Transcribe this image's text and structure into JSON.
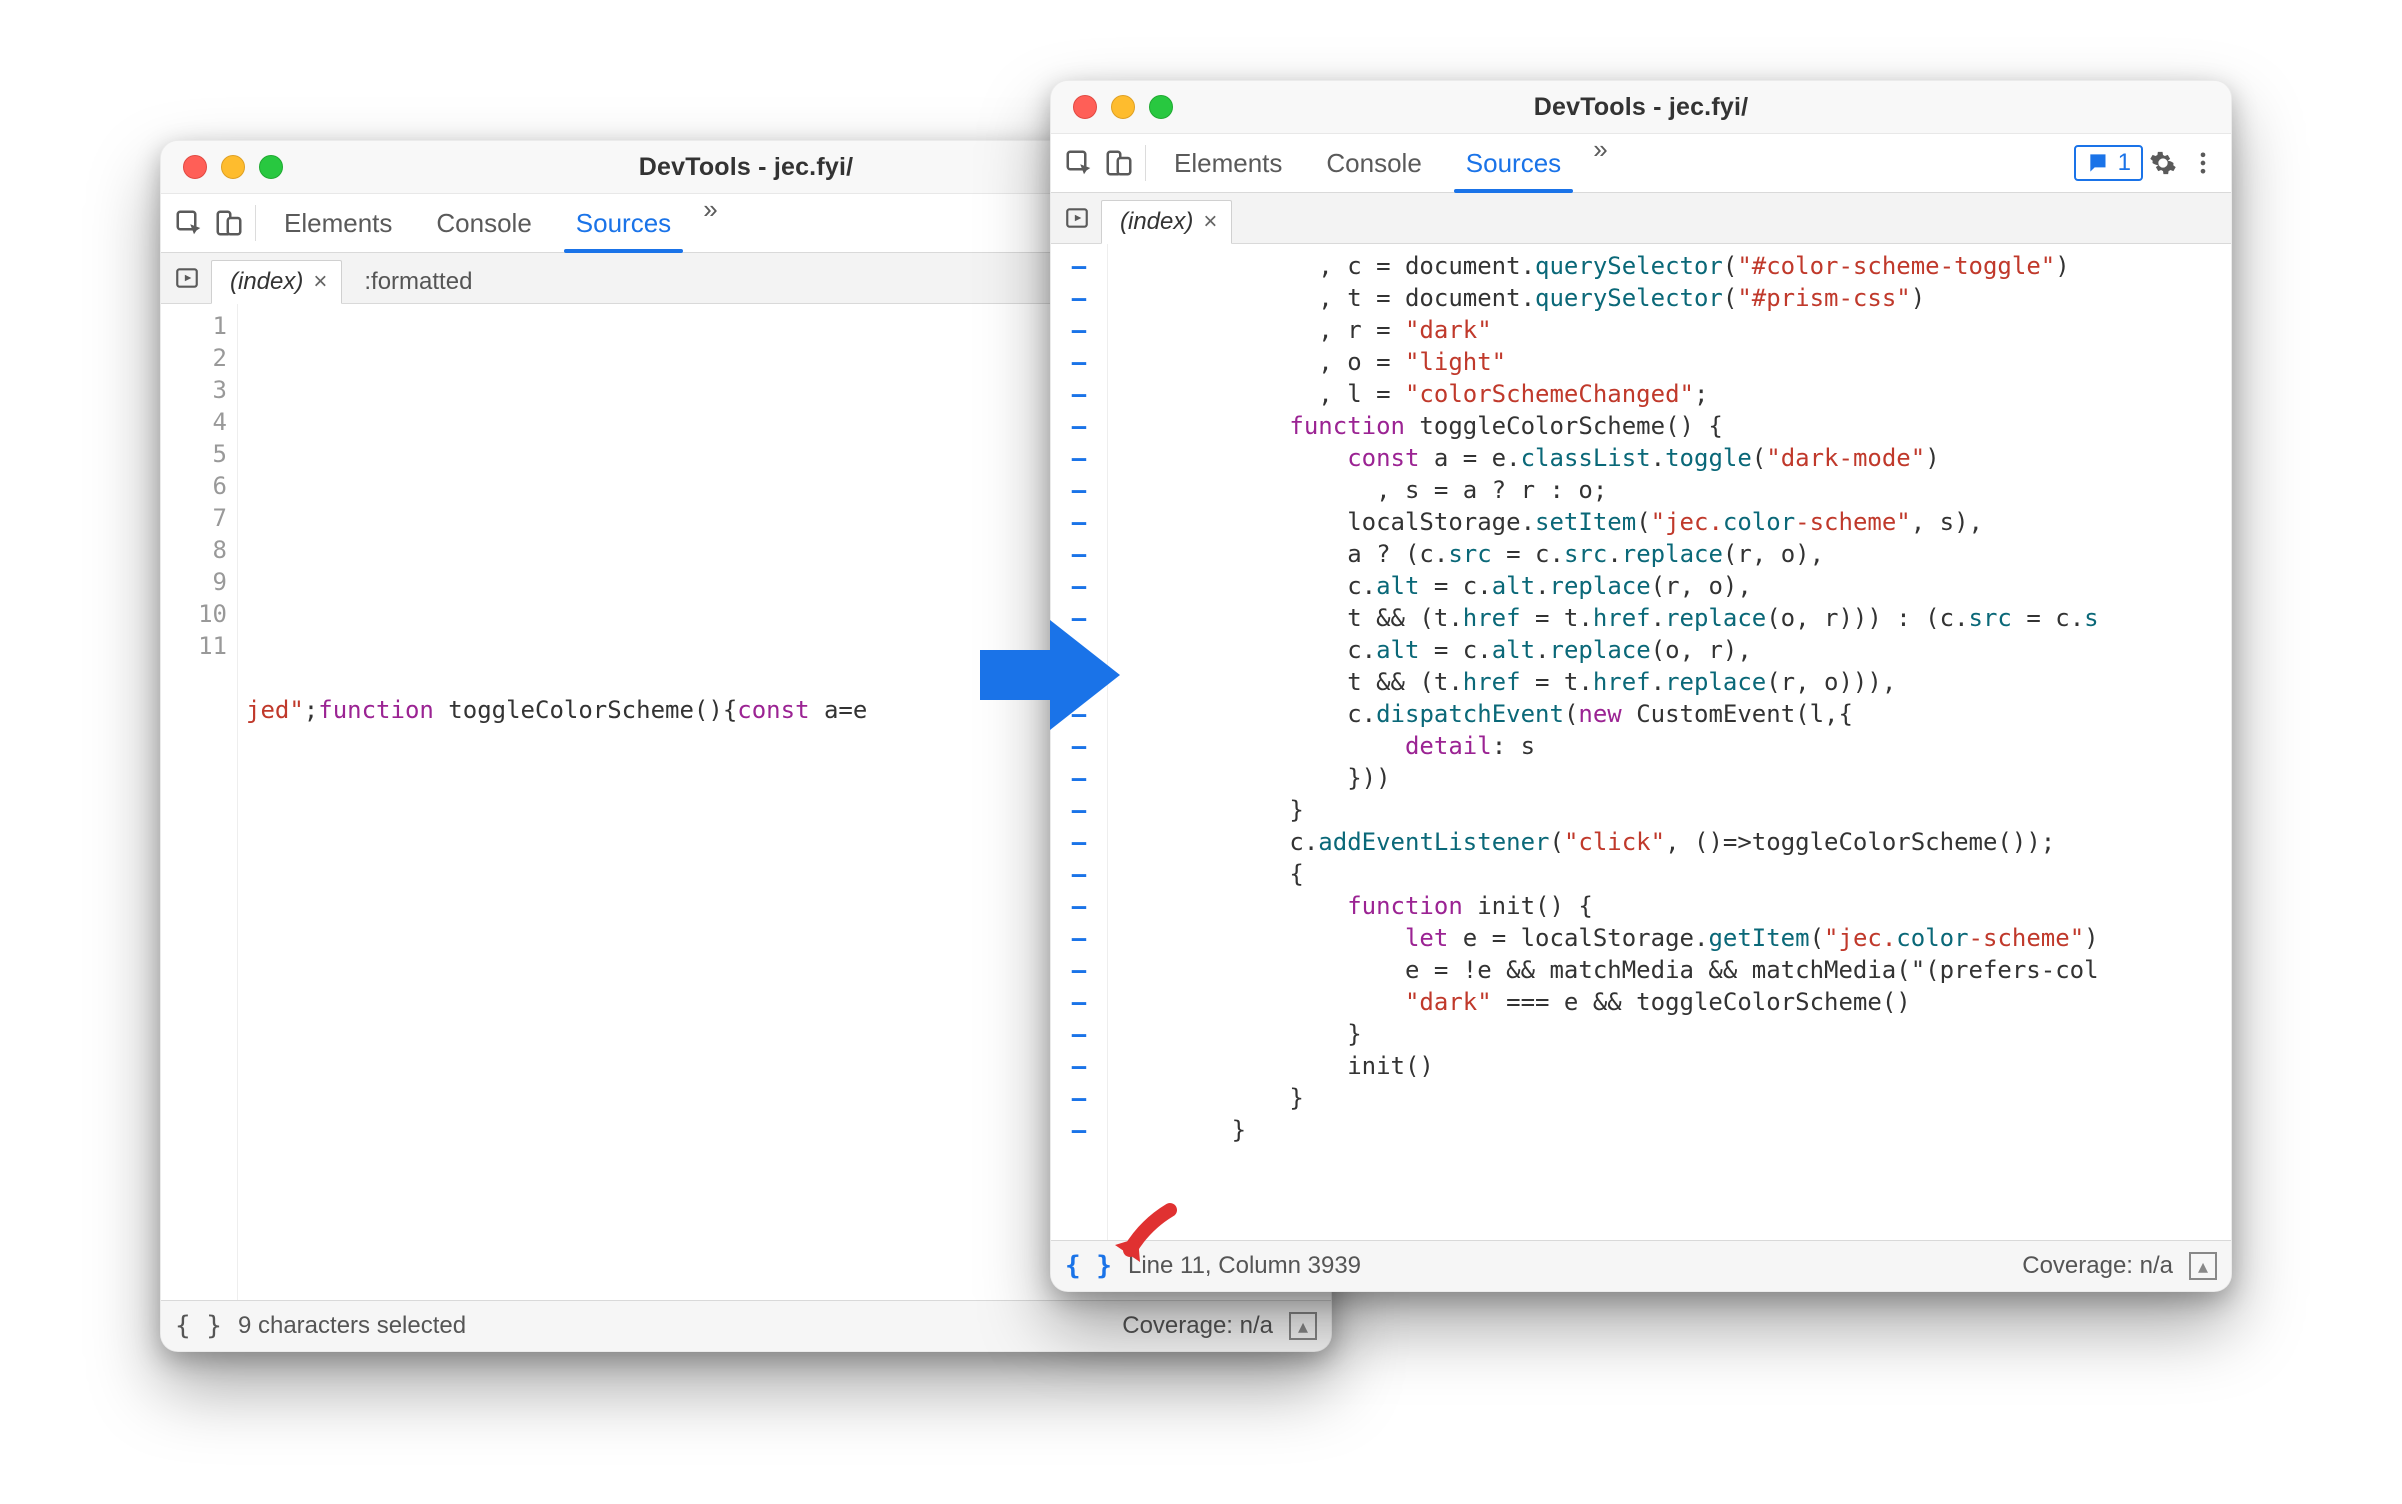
{
  "left": {
    "title": "DevTools - jec.fyi/",
    "tabs": [
      "Elements",
      "Console",
      "Sources"
    ],
    "active_tab": "Sources",
    "more": "»",
    "filetab": "(index)",
    "ghost_tab": ":formatted",
    "gutter": [
      "1",
      "2",
      "3",
      "4",
      "5",
      "6",
      "7",
      "8",
      "9",
      "10",
      "11"
    ],
    "line11_pre": "jed\"",
    "line11_mid": ";",
    "line11_fn": "function",
    "line11_name": " toggleColorScheme(){",
    "line11_const": "const",
    "line11_rest": " a=e",
    "status_pretty": "{ }",
    "status_msg": "9 characters selected",
    "status_cov": "Coverage: n/a"
  },
  "right": {
    "title": "DevTools - jec.fyi/",
    "tabs": [
      "Elements",
      "Console",
      "Sources"
    ],
    "active_tab": "Sources",
    "more": "»",
    "issues_count": "1",
    "filetab": "(index)",
    "code": {
      "l1": "              , c = document.querySelector(\"#color-scheme-toggle\")",
      "l2": "              , t = document.querySelector(\"#prism-css\")",
      "l3": "              , r = \"dark\"",
      "l4": "              , o = \"light\"",
      "l5": "              , l = \"colorSchemeChanged\";",
      "l6": "            function toggleColorScheme() {",
      "l7": "                const a = e.classList.toggle(\"dark-mode\")",
      "l8": "                  , s = a ? r : o;",
      "l9": "                localStorage.setItem(\"jec.color-scheme\", s),",
      "l10": "                a ? (c.src = c.src.replace(r, o),",
      "l11": "                c.alt = c.alt.replace(r, o),",
      "l12": "                t && (t.href = t.href.replace(o, r))) : (c.src = c.s",
      "l13": "                c.alt = c.alt.replace(o, r),",
      "l14": "                t && (t.href = t.href.replace(r, o))),",
      "l15": "                c.dispatchEvent(new CustomEvent(l,{",
      "l16": "                    detail: s",
      "l17": "                }))",
      "l18": "            }",
      "l19": "            c.addEventListener(\"click\", ()=>toggleColorScheme());",
      "l20": "            {",
      "l21": "                function init() {",
      "l22": "                    let e = localStorage.getItem(\"jec.color-scheme\")",
      "l23": "                    e = !e && matchMedia && matchMedia(\"(prefers-col",
      "l24": "                    \"dark\" === e && toggleColorScheme()",
      "l25": "                }",
      "l26": "                init()",
      "l27": "            }",
      "l28": "        }"
    },
    "status_pretty": "{ }",
    "status_msg": "Line 11, Column 3939",
    "status_cov": "Coverage: n/a"
  }
}
